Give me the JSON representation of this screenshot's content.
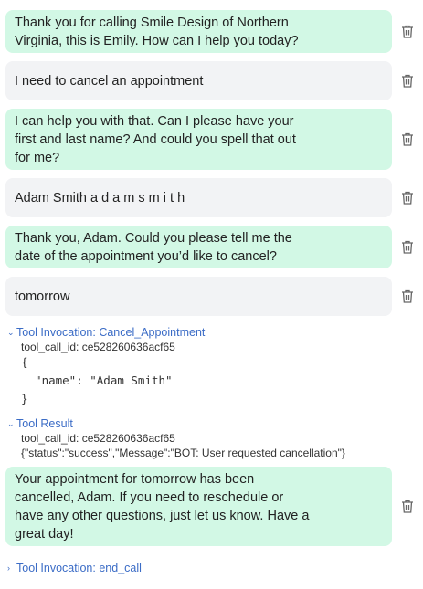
{
  "messages": [
    {
      "role": "bot",
      "text": "Thank you for calling Smile Design of Northern\nVirginia, this is Emily. How can I help you today?"
    },
    {
      "role": "user",
      "text": "I need to cancel an appointment"
    },
    {
      "role": "bot",
      "text": "I can help you with that. Can I please have your\nfirst and last name? And could you spell that out\nfor me?"
    },
    {
      "role": "user",
      "text": "Adam Smith a d a m s m i t h"
    },
    {
      "role": "bot",
      "text": "Thank you, Adam. Could you please tell me the\ndate of the appointment you’d like to cancel?"
    },
    {
      "role": "user",
      "text": "tomorrow"
    },
    {
      "role": "bot",
      "text": "Your appointment for tomorrow has been\ncancelled, Adam. If you need to reschedule or\nhave any other questions, just let us know. Have a\ngreat day!"
    }
  ],
  "tool_invocation": {
    "label": "Tool Invocation: Cancel_Appointment",
    "call_id": "tool_call_id: ce528260636acf65",
    "code_open": "{",
    "code_body": "  \"name\": \"Adam Smith\"",
    "code_close": "}"
  },
  "tool_result": {
    "label": "Tool Result",
    "call_id": "tool_call_id: ce528260636acf65",
    "result": "{\"status\":\"success\",\"Message\":\"BOT: User requested cancellation\"}"
  },
  "end_call": {
    "label": "Tool Invocation: end_call"
  },
  "icons": {
    "delete": "trash-icon",
    "expanded": "chevron-down-icon",
    "collapsed": "chevron-right-icon"
  },
  "colors": {
    "bot_bubble": "#d2f8e5",
    "user_bubble": "#f2f3f5",
    "tool_link": "#3b6cc6"
  }
}
